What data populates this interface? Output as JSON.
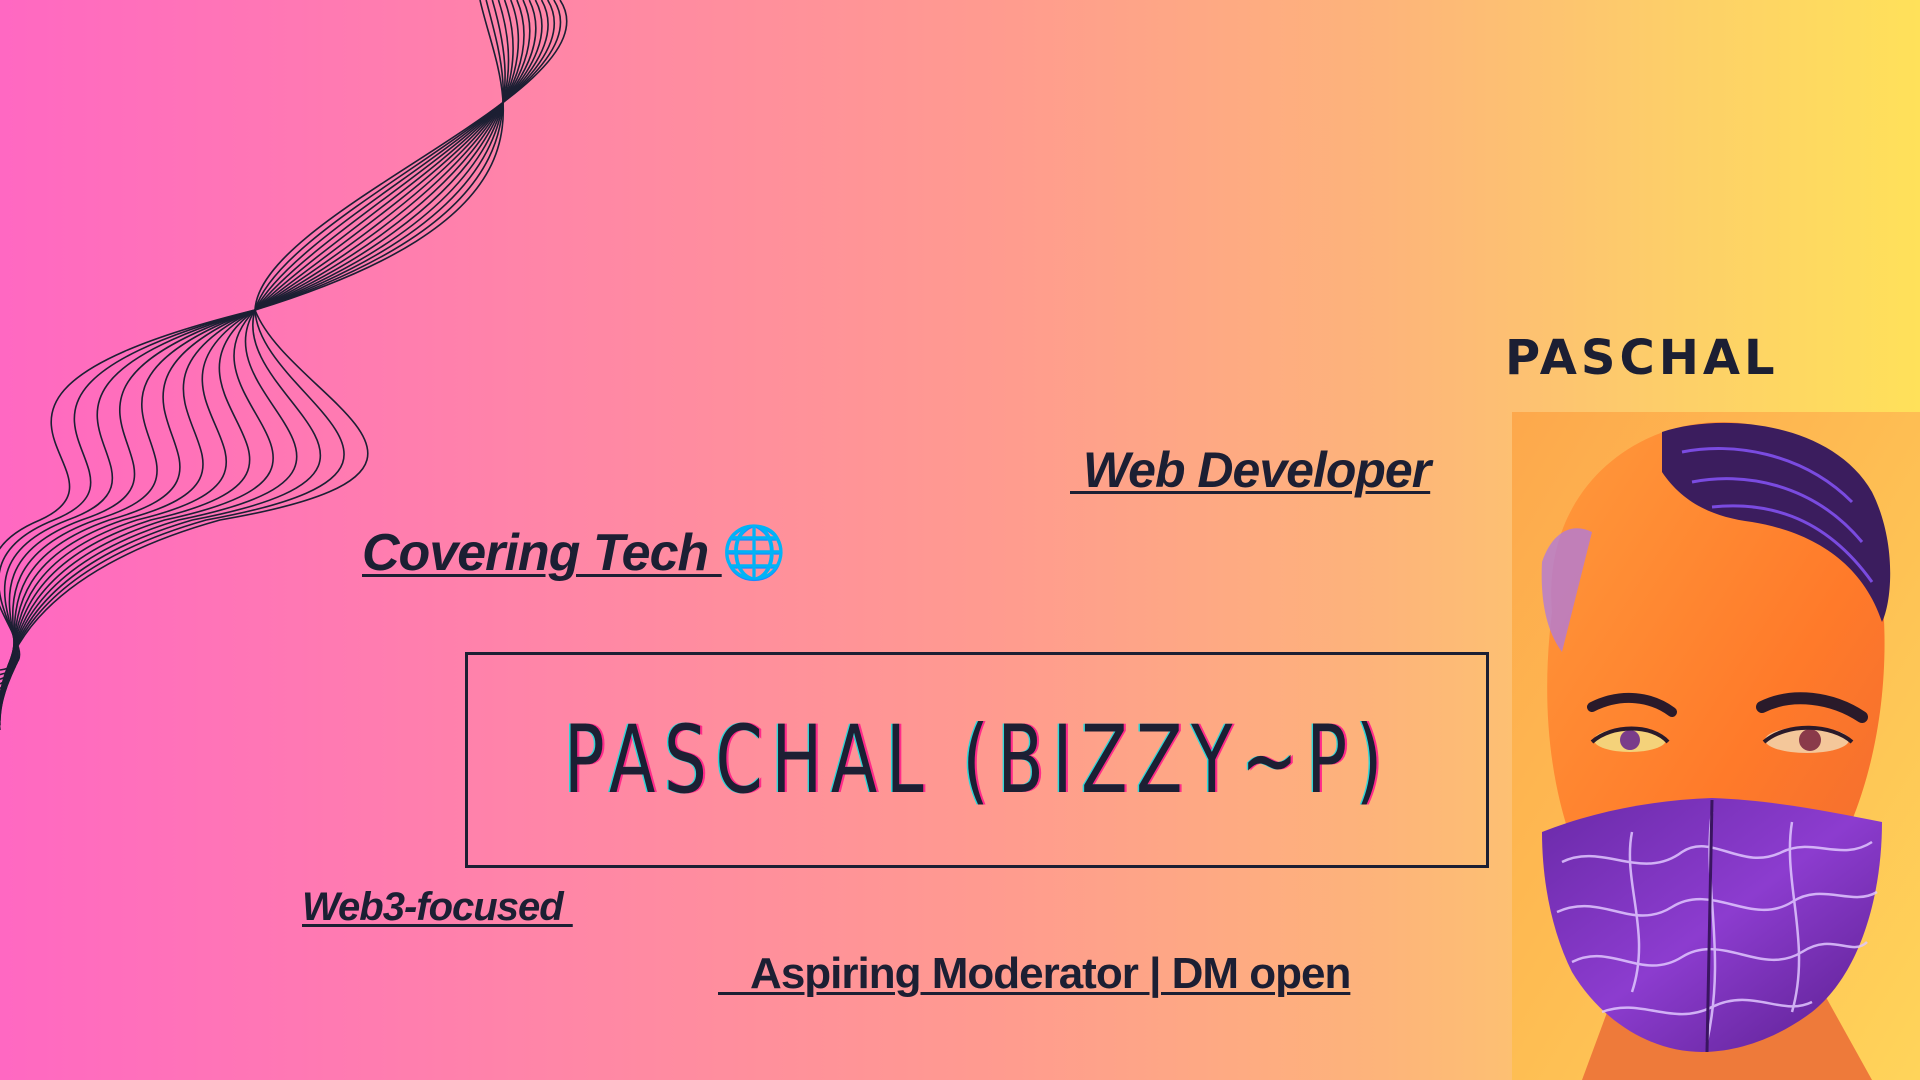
{
  "header": {
    "name_label": "PASCHAL"
  },
  "tags": {
    "web_developer": " Web Developer",
    "covering_tech": "Covering Tech ",
    "covering_tech_icon": "🌐",
    "web3": "Web3-focused ",
    "moderator": "   Aspiring Moderator | DM open"
  },
  "banner": {
    "title": "PASCHAL (BIZZY~P)"
  },
  "colors": {
    "gradient_left": "#ff68c2",
    "gradient_right": "#ffe15a",
    "text": "#1c1f33",
    "accent_cyan": "#2fd6d8",
    "accent_pink": "#ff2a8a"
  },
  "images": {
    "portrait": "stylized-portrait-with-mask",
    "decoration": "line-wave-decoration"
  }
}
